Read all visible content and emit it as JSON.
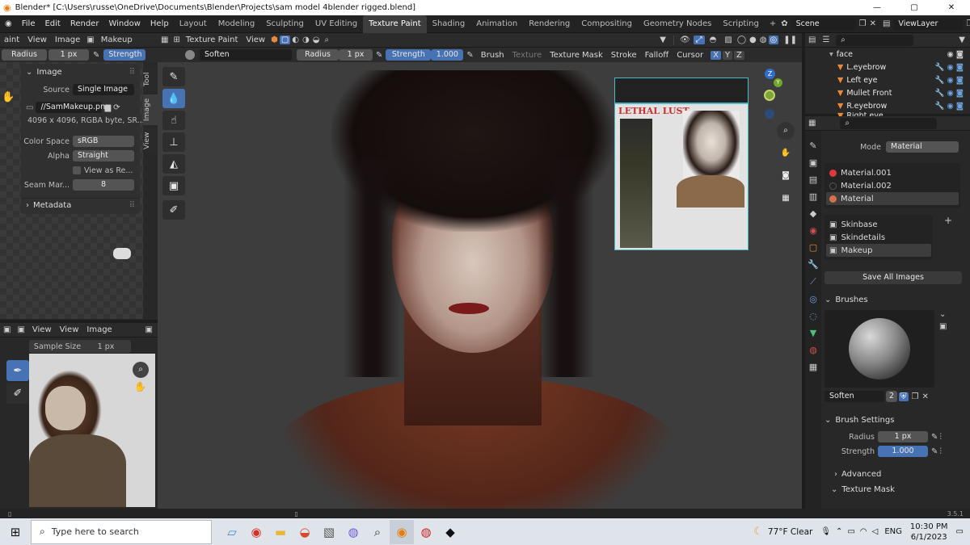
{
  "titlebar": {
    "title": "Blender* [C:\\Users\\russe\\OneDrive\\Documents\\Blender\\Projects\\sam model 4blender rigged.blend]"
  },
  "menu": {
    "items": [
      "File",
      "Edit",
      "Render",
      "Window",
      "Help"
    ]
  },
  "workspaces": [
    "Layout",
    "Modeling",
    "Sculpting",
    "UV Editing",
    "Texture Paint",
    "Shading",
    "Animation",
    "Rendering",
    "Compositing",
    "Geometry Nodes",
    "Scripting"
  ],
  "scene": {
    "label": "Scene",
    "view_layer": "ViewLayer"
  },
  "image_editor": {
    "header": {
      "mode": "aint",
      "view": "View",
      "image": "Image",
      "paint": "Makeup"
    },
    "tool_settings": {
      "radius_label": "Radius",
      "radius_value": "1 px",
      "strength_label": "Strength"
    },
    "tabs": [
      "Tool",
      "Image",
      "View"
    ],
    "panel_title": "Image",
    "source_label": "Source",
    "source_value": "Single Image",
    "file_name": "//SamMakeup.png",
    "info": "4096 x 4096, RGBA byte, SR...",
    "color_space_label": "Color Space",
    "color_space_value": "sRGB",
    "alpha_label": "Alpha",
    "alpha_value": "Straight",
    "view_as_render": "View as Re...",
    "seam_label": "Seam Mar...",
    "seam_value": "8",
    "metadata": "Metadata"
  },
  "image_editor2": {
    "header": {
      "view1": "View",
      "view2": "View",
      "image": "Image"
    },
    "sample_label": "Sample Size",
    "sample_value": "1 px"
  },
  "viewport": {
    "header": {
      "mode": "Texture Paint",
      "view": "View"
    },
    "tool_bar": {
      "brush": "Soften",
      "radius_label": "Radius",
      "radius_value": "1 px",
      "strength_label": "Strength",
      "strength_value": "1.000",
      "brush_menu": "Brush",
      "texture": "Texture",
      "texture_mask": "Texture Mask",
      "stroke": "Stroke",
      "falloff": "Falloff",
      "cursor": "Cursor",
      "x": "X",
      "y": "Y",
      "z": "Z"
    },
    "gizmo": {
      "z": "Z",
      "y": "Y"
    },
    "reference_text": "LETHAL LUST"
  },
  "outliner": {
    "rows": [
      {
        "name": "face"
      },
      {
        "name": "L.eyebrow"
      },
      {
        "name": "Left eye"
      },
      {
        "name": "Mullet Front"
      },
      {
        "name": "R.eyebrow"
      },
      {
        "name": "Right eye"
      }
    ]
  },
  "properties": {
    "mode_label": "Mode",
    "mode_value": "Material",
    "materials": [
      {
        "name": "Material.001",
        "color": "#e0383a"
      },
      {
        "name": "Material.002",
        "color": "#222222"
      },
      {
        "name": "Material",
        "color": "#d4704a"
      }
    ],
    "textures": [
      "Skinbase",
      "Skindetails",
      "Makeup"
    ],
    "save_all": "Save All Images",
    "brushes_title": "Brushes",
    "brush_name": "Soften",
    "brush_users": "2",
    "brush_settings_title": "Brush Settings",
    "radius_label": "Radius",
    "radius_value": "1 px",
    "strength_label": "Strength",
    "strength_value": "1.000",
    "advanced": "Advanced",
    "texture_mask": "Texture Mask"
  },
  "statusbar": {
    "version": "3.5.1"
  },
  "taskbar": {
    "search_placeholder": "Type here to search",
    "weather": "77°F  Clear",
    "lang": "ENG",
    "time": "10:30 PM",
    "date": "6/1/2023"
  },
  "colors": {
    "accent": "#4772b3",
    "header": "#2b2b2b",
    "panel": "#303030"
  }
}
